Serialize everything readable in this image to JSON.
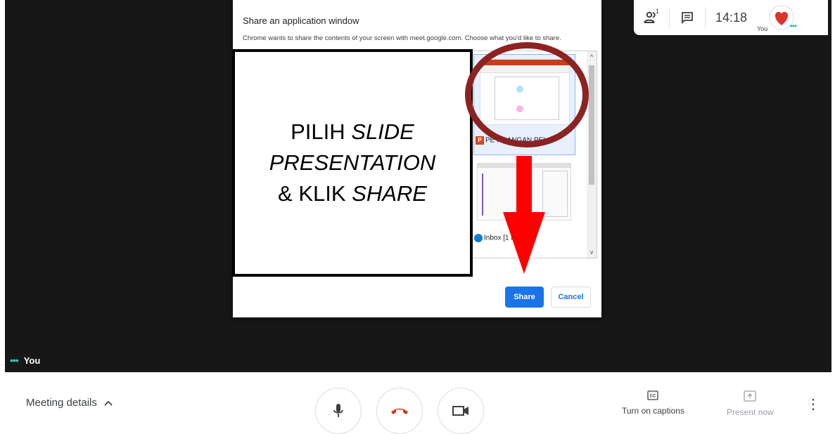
{
  "topbar": {
    "people_icon": "people-icon",
    "people_count": "1",
    "chat_icon": "chat-icon",
    "time": "14:18",
    "you_label": "You",
    "avatar_icon": "heart-avatar-icon"
  },
  "dialog": {
    "title": "Share an application window",
    "description": "Chrome wants to share the contents of your screen with meet.google.com. Choose what you'd like to share.",
    "windows": [
      {
        "label": "PERANCANGAN PELA",
        "label_visible": "PE      NCANGAN PELA",
        "icon": "powerpoint-icon",
        "selected": true
      },
      {
        "label_visible": "Inbox [1          r Han...",
        "icon": "edge-icon",
        "selected": false
      }
    ],
    "share_label": "Share",
    "cancel_label": "Cancel"
  },
  "annotation": {
    "line1": "PILIH ",
    "line1_italic": "SLIDE",
    "line2_italic": "PRESENTATION",
    "line3": "& KLIK ",
    "line3_italic": "SHARE",
    "circle_color": "#8b2323",
    "arrow_color": "#ff0000"
  },
  "stage": {
    "you_label": "You"
  },
  "bottom": {
    "meeting_details": "Meeting details",
    "captions_label": "Turn on captions",
    "present_label": "Present now"
  },
  "colors": {
    "accent": "#1a73e8",
    "hangup": "#d93025",
    "speaking": "#2ec4b6"
  }
}
